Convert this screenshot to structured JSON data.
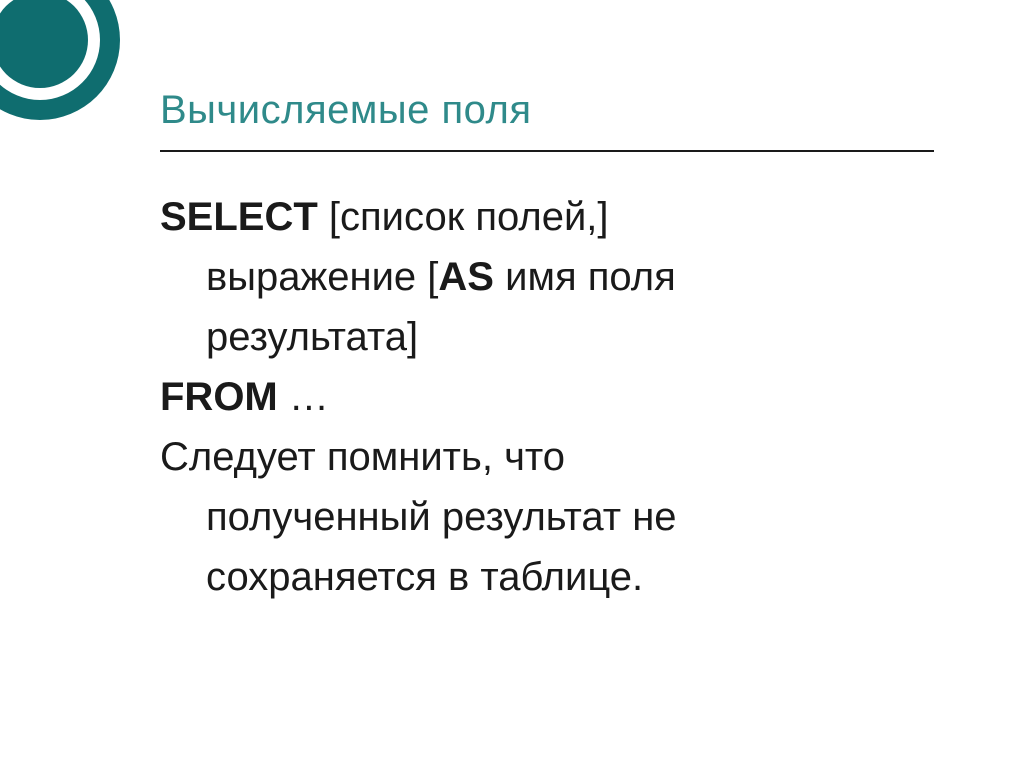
{
  "title": "Вычисляемые поля",
  "sql": {
    "select_kw": "SELECT",
    "select_tail": " [список полей,]",
    "line2": "выражение [",
    "as_kw": "AS",
    "line2_tail": " имя поля",
    "line3": "результата]",
    "from_kw": "FROM",
    "from_tail": " …"
  },
  "note": {
    "l1": "Следует помнить, что",
    "l2": "полученный результат не",
    "l3": "сохраняется в таблице."
  }
}
